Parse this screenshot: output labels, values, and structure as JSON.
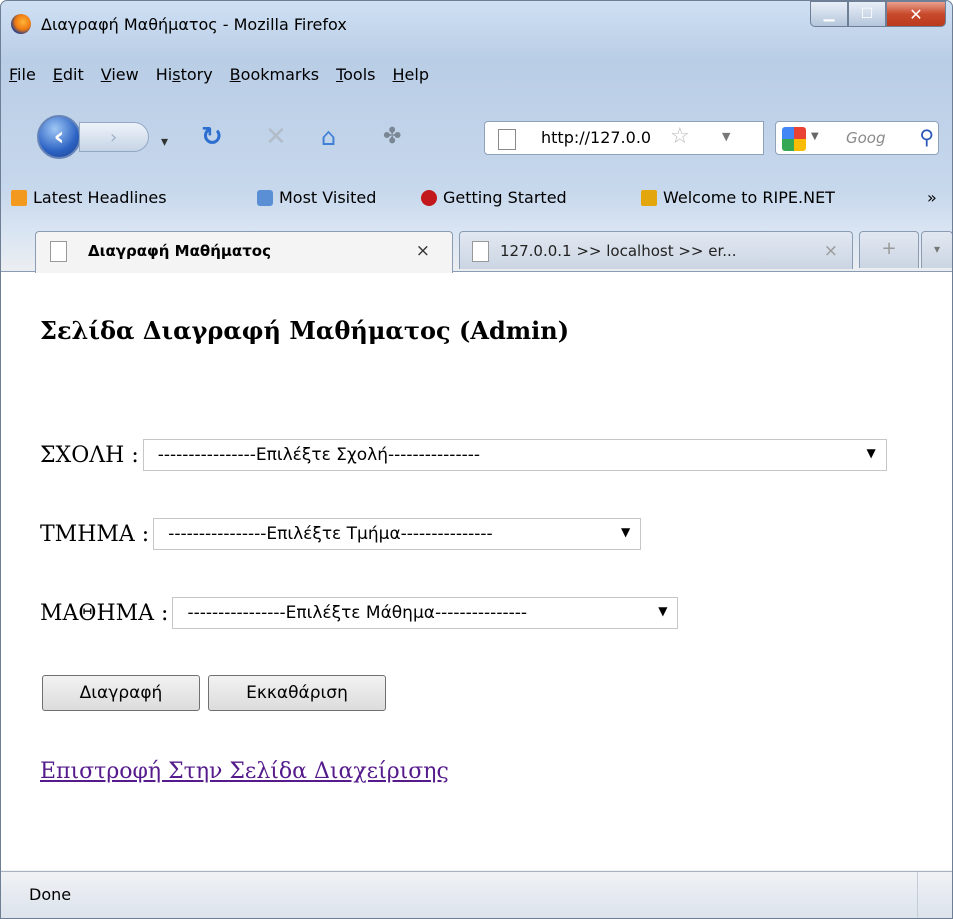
{
  "window": {
    "title": "Διαγραφή Μαθήματος - Mozilla Firefox"
  },
  "menu": [
    {
      "key": "F",
      "rest": "ile"
    },
    {
      "key": "E",
      "rest": "dit"
    },
    {
      "key": "V",
      "rest": "iew"
    },
    {
      "pre": "Hi",
      "key": "s",
      "rest": "tory"
    },
    {
      "key": "B",
      "rest": "ookmarks"
    },
    {
      "key": "T",
      "rest": "ools"
    },
    {
      "key": "H",
      "rest": "elp"
    }
  ],
  "navigation": {
    "url": "http://127.0.0",
    "search_placeholder": "Goog"
  },
  "bookmarks": [
    "Latest Headlines",
    "Most Visited",
    "Getting Started",
    "Welcome to RIPE.NET",
    "»"
  ],
  "tabs": [
    {
      "label": "Διαγραφή Μαθήματος",
      "close": "×"
    },
    {
      "label": "127.0.0.1 >> localhost >> er...",
      "close": "×"
    }
  ],
  "new_tab": "+",
  "page": {
    "heading": "Σελίδα Διαγραφή Μαθήματος (Admin)",
    "school_label": "ΣΧΟΛΗ :",
    "school_value": "----------------Επιλέξτε Σχολή---------------",
    "department_label": "ΤΜΗΜΑ :",
    "department_value": "----------------Επιλέξτε Τμήμα---------------",
    "course_label": "ΜΑΘΗΜΑ :",
    "course_value": "----------------Επιλέξτε Μάθημα---------------",
    "delete_button": "Διαγραφή",
    "clear_button": "Εκκαθάριση",
    "back_link": "Επιστροφή Στην Σελίδα Διαχείρισης"
  },
  "status": {
    "text": "Done"
  }
}
